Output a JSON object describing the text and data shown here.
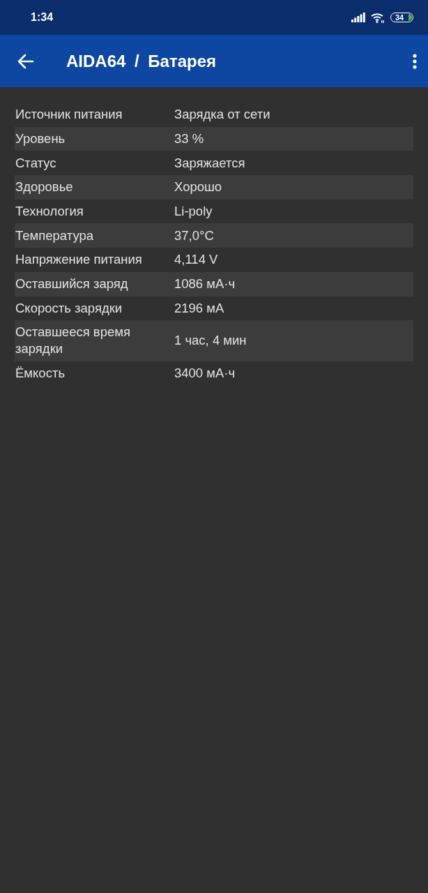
{
  "status_bar": {
    "time": "1:34",
    "battery": "34"
  },
  "app_bar": {
    "title": "AIDA64 / Батарея"
  },
  "rows": [
    {
      "label": "Источник питания",
      "value": "Зарядка от сети"
    },
    {
      "label": "Уровень",
      "value": "33 %"
    },
    {
      "label": "Статус",
      "value": "Заряжается"
    },
    {
      "label": "Здоровье",
      "value": "Хорошо"
    },
    {
      "label": "Технология",
      "value": "Li-poly"
    },
    {
      "label": "Температура",
      "value": "37,0°C"
    },
    {
      "label": "Напряжение питания",
      "value": "4,114 V"
    },
    {
      "label": "Оставшийся заряд",
      "value": "1086 мА·ч"
    },
    {
      "label": "Скорость зарядки",
      "value": "2196 мА"
    },
    {
      "label": "Оставшееся время зарядки",
      "value": "1 час, 4 мин"
    },
    {
      "label": "Ёмкость",
      "value": "3400 мА·ч"
    }
  ]
}
